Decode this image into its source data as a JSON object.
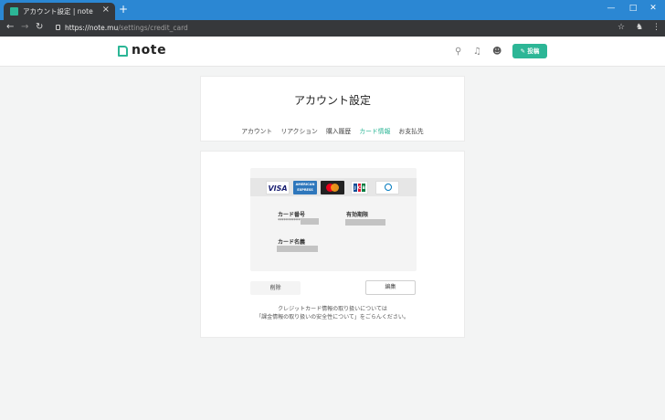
{
  "browser": {
    "tab_title": "アカウント設定 | note",
    "tab_close": "×",
    "new_tab": "+",
    "window_controls": {
      "minimize": "—",
      "maximize": "□",
      "close": "✕"
    },
    "url_host": "https://note.mu",
    "url_path": "/settings/credit_card",
    "icons": [
      "back-icon",
      "forward-icon",
      "reload-icon",
      "lock-icon",
      "star-icon",
      "extension-icon",
      "menu-icon"
    ]
  },
  "header": {
    "logo": "note",
    "post_button": "✎ 投稿",
    "icons": [
      "search-icon",
      "bell-icon",
      "avatar-icon"
    ]
  },
  "settings": {
    "title": "アカウント設定",
    "tabs": [
      {
        "label": "アカウント",
        "active": false
      },
      {
        "label": "リアクション",
        "active": false
      },
      {
        "label": "購入履歴",
        "active": false
      },
      {
        "label": "カード情報",
        "active": true
      },
      {
        "label": "お支払先",
        "active": false
      }
    ]
  },
  "card": {
    "brands": {
      "visa": "VISA",
      "amex": "AMERICAN EXPRESS",
      "master": "MasterCard",
      "jcb": [
        "J",
        "C",
        "B"
      ],
      "diners": "Diners Club"
    },
    "number_label": "カード番号",
    "number_value": "************",
    "expiry_label": "有効期限",
    "name_label": "カード名義",
    "delete_button": "削除",
    "edit_button": "編集",
    "notice_line1": "クレジットカード情報の取り扱いについては",
    "notice_line2": "「課金情報の取り扱いの安全性について」をごらんください。"
  },
  "colors": {
    "accent": "#2cb696",
    "chrome": "#2b87d3",
    "toolbar": "#36383b"
  }
}
